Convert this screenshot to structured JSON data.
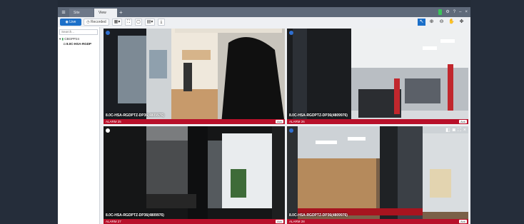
{
  "titlebar": {
    "tabs": [
      {
        "label": "Site Login"
      },
      {
        "label": "View 1",
        "close": "×"
      }
    ],
    "add_tab": "+",
    "right_icons": {
      "help": "?",
      "minimize": "–",
      "settings": "⚙",
      "close": "×"
    }
  },
  "toolbar": {
    "live_label": "Live",
    "recorded_label": "Recorded",
    "layout_icon": "▦▾",
    "fullscreen_icon": "⛶",
    "blank_icon": "▢",
    "save_icon": "▤▾",
    "export_icon": "⤓",
    "right_tools": {
      "pointer": "↖",
      "zoom_in": "⊕",
      "zoom_out": "⊖",
      "pan": "✋",
      "ptz": "✥"
    }
  },
  "sidebar": {
    "search_placeholder": "Search...",
    "tree": [
      {
        "label": "CBGPP24"
      },
      {
        "label": "8.0C-HSA-RGDP"
      }
    ]
  },
  "cameras": [
    {
      "name": "8.0C-HSA-RGDPTZ-DP36(4809976)",
      "alarm": "ALARM 25",
      "ack": "Ack",
      "status_color": "#2f6fd0"
    },
    {
      "name": "8.0C-HSA-RGDPTZ-DP36(4809976)",
      "alarm": "ALARM 26",
      "ack": "Ack",
      "status_color": "#2f6fd0"
    },
    {
      "name": "8.0C-HSA-RGDPTZ-DP36(4809976)",
      "alarm": "ALARM 27",
      "ack": "Ack",
      "status_color": "#ffffff"
    },
    {
      "name": "8.0C-HSA-RGDPTZ-DP36(4809976)",
      "alarm": "ALARM 28",
      "ack": "Ack",
      "status_color": "#2f6fd0"
    }
  ],
  "colors": {
    "alarm_bar": "#b8102a",
    "accent": "#1b6fc9",
    "titlebar": "#5f6a7a"
  }
}
